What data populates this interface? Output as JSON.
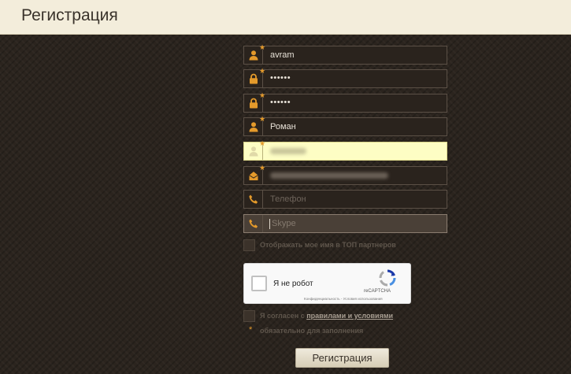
{
  "header": {
    "title": "Регистрация"
  },
  "fields": {
    "login": {
      "value": "avram",
      "required": true,
      "icon": "user-icon"
    },
    "password": {
      "value": "••••••",
      "required": true,
      "icon": "lock-icon"
    },
    "password_confirm": {
      "value": "••••••",
      "required": true,
      "icon": "lock-icon"
    },
    "first_name": {
      "value": "Роман",
      "required": true,
      "icon": "user-icon"
    },
    "last_name": {
      "required": true,
      "icon": "user-icon"
    },
    "email": {
      "required": true,
      "icon": "mail-icon"
    },
    "phone": {
      "placeholder": "Телефон",
      "icon": "phone-icon"
    },
    "skype": {
      "placeholder": "Skype",
      "icon": "phone-icon"
    }
  },
  "show_name_top": {
    "label": "Отображать мое имя в ТОП партнеров"
  },
  "recaptcha": {
    "label": "Я не робот",
    "brand": "reCAPTCHA",
    "terms": "Конфиденциальность - Условия использования"
  },
  "agree": {
    "label_prefix": "Я согласен с ",
    "link": "правилами и условиями"
  },
  "required_note": {
    "star": "*",
    "text": "обязательно для заполнения"
  },
  "submit": {
    "label": "Регистрация"
  },
  "colors": {
    "accent": "#e49a2b",
    "header_bg": "#f3eddb",
    "autofill": "#fdfdc4"
  }
}
